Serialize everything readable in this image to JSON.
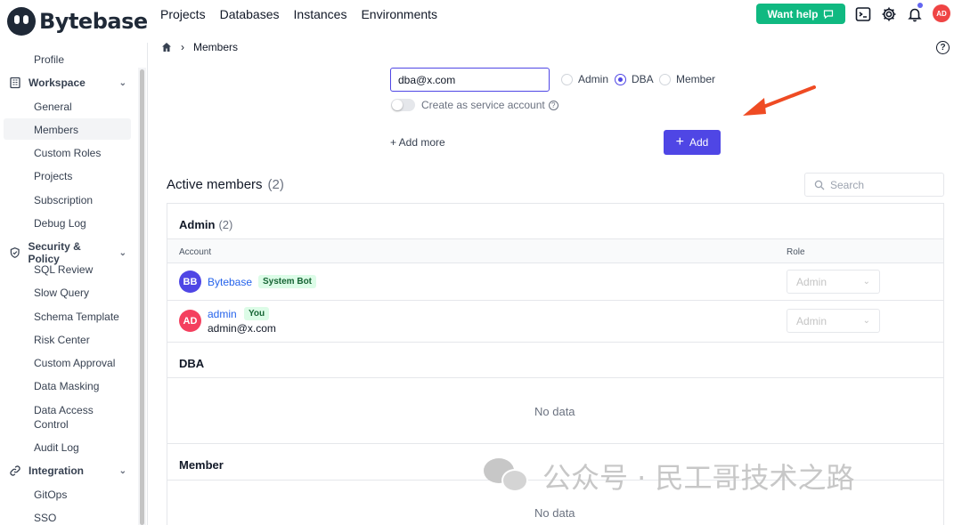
{
  "brand": {
    "name": "Bytebase"
  },
  "nav": {
    "items": [
      "Projects",
      "Databases",
      "Instances",
      "Environments"
    ]
  },
  "header": {
    "help_label": "Want help",
    "avatar_initials": "AD"
  },
  "sidebar": {
    "profile": "Profile",
    "workspace": {
      "label": "Workspace",
      "items": [
        "General",
        "Members",
        "Custom Roles",
        "Projects",
        "Subscription",
        "Debug Log"
      ]
    },
    "security": {
      "label": "Security & Policy",
      "items": [
        "SQL Review",
        "Slow Query",
        "Schema Template",
        "Risk Center",
        "Custom Approval",
        "Data Masking",
        "Data Access",
        "Control",
        "Audit Log"
      ]
    },
    "integration": {
      "label": "Integration",
      "items": [
        "GitOps",
        "SSO"
      ]
    }
  },
  "breadcrumb": {
    "current": "Members"
  },
  "invite": {
    "email_value": "dba@x.com",
    "roles": [
      "Admin",
      "DBA",
      "Member"
    ],
    "selected_role": "DBA",
    "service_account_label": "Create as service account",
    "service_account_enabled": false,
    "add_more_label": "+ Add more",
    "add_button_label": "Add"
  },
  "active_members": {
    "title": "Active members",
    "count": "(2)",
    "search_placeholder": "Search",
    "columns": [
      "Account",
      "Role"
    ],
    "groups": [
      {
        "name": "Admin",
        "count": "(2)",
        "members": [
          {
            "initials": "BB",
            "name": "Bytebase",
            "badge": "System Bot",
            "email": "",
            "role": "Admin",
            "avatar_color": "#4f46e5"
          },
          {
            "initials": "AD",
            "name": "admin",
            "badge": "You",
            "email": "admin@x.com",
            "role": "Admin",
            "avatar_color": "#ef4444"
          }
        ]
      },
      {
        "name": "DBA",
        "count": "",
        "empty_text": "No data"
      },
      {
        "name": "Member",
        "count": "",
        "empty_text": "No data"
      }
    ]
  },
  "watermark": {
    "text": "公众号 · 民工哥技术之路"
  },
  "colors": {
    "accent": "#4f46e5",
    "help_green": "#10b981",
    "arrow": "#ef4b23"
  }
}
